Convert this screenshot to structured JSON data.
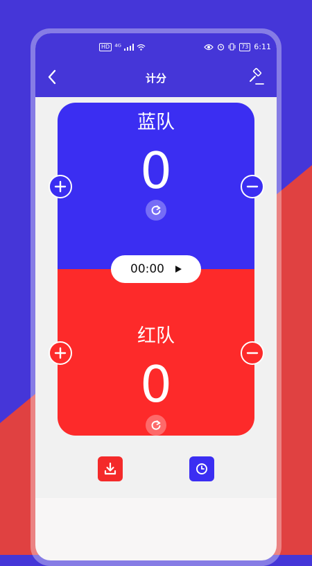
{
  "status_bar": {
    "left_badge": "HD",
    "network": "⁴ᴳ",
    "battery": "73",
    "time": "6:11"
  },
  "nav": {
    "title": "计分",
    "back_icon": "chevron-left-icon",
    "right_icon": "gavel-icon"
  },
  "teams": {
    "blue": {
      "name": "蓝队",
      "score": "0",
      "color": "#3b2ef2"
    },
    "red": {
      "name": "红队",
      "score": "0",
      "color": "#fd2a2a"
    }
  },
  "timer": {
    "time": "00:00"
  },
  "colors": {
    "primary": "#4536d8",
    "blue_team": "#3b2ef2",
    "red_team": "#fd2a2a",
    "download_button": "#f42a2a",
    "history_button": "#3b2ef2"
  },
  "bottom_actions": {
    "download_icon": "download-icon",
    "history_icon": "clock-icon"
  }
}
